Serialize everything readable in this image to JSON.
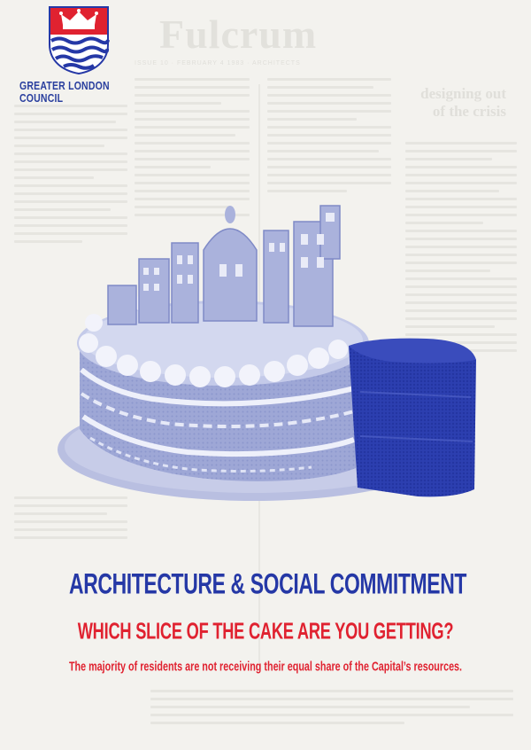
{
  "background": {
    "masthead": "Fulcrum",
    "issue_line": "ISSUE 10 · FEBRUARY 4 1983 · ARCHITECTS",
    "headline": "designing out of the crisis"
  },
  "logo": {
    "name": "GREATER LONDON COUNCIL",
    "emblem": "crown-and-waves-shield-icon"
  },
  "illustration": {
    "subject": "cake-with-cut-slice"
  },
  "headline": {
    "title": "ARCHITECTURE & SOCIAL COMMITMENT",
    "subtitle": "WHICH SLICE OF THE CAKE ARE YOU GETTING?",
    "tagline": "The majority of residents are not receiving their equal share of the Capital’s resources."
  },
  "colors": {
    "paper": "#f3f2ee",
    "blue": "#2538a6",
    "red": "#e02230",
    "cake_light": "#a7afd8",
    "cake_dark": "#2c3fb0"
  }
}
